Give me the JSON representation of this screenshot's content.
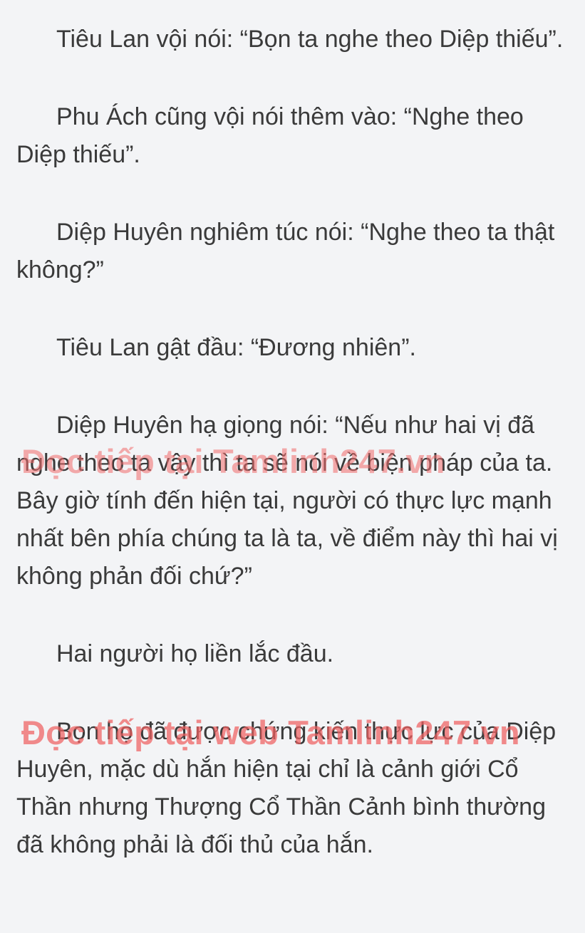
{
  "document": {
    "paragraphs": [
      "Tiêu Lan vội nói: “Bọn ta nghe theo Diệp thiếu”.",
      "Phu Ách cũng vội nói thêm vào: “Nghe theo Diệp thiếu”.",
      "Diệp Huyên nghiêm túc nói: “Nghe theo ta thật không?”",
      "Tiêu Lan gật đầu: “Đương nhiên”.",
      "Diệp Huyên hạ giọng nói: “Nếu như hai vị đã nghe theo ta vậy thì ta sẽ nói về biện pháp của ta. Bây giờ tính đến hiện tại, người có thực lực mạnh nhất bên phía chúng ta là ta, về điểm này thì hai vị không phản đối chứ?”",
      "Hai người họ liền lắc đầu.",
      "Bọn họ đã được chứng kiến thực lực của Diệp Huyên, mặc dù hắn hiện tại chỉ là cảnh giới Cổ Thần nhưng Thượng Cổ Thần Cảnh bình thường đã không phải là đối thủ của hắn."
    ]
  },
  "watermarks": {
    "first": "Đọc tiếp tại Tamlinh247.vn",
    "second": "Đọc tiếp tại web Tamlinh247.vn"
  },
  "colors": {
    "background": "#f3f4f6",
    "text": "#3a3a3a",
    "watermark": "#ef5f5f"
  }
}
